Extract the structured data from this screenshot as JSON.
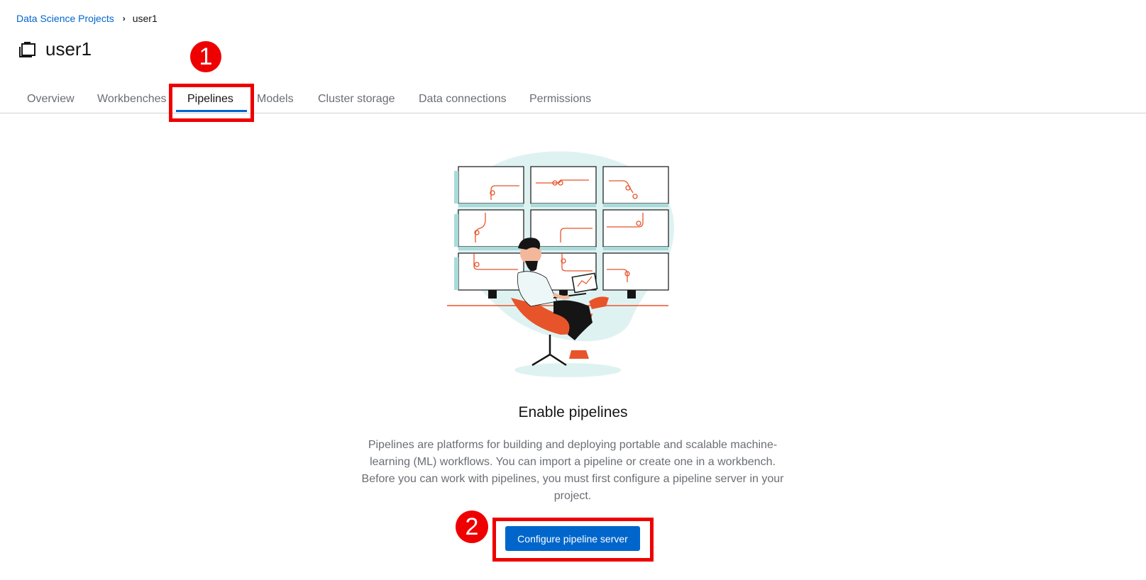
{
  "breadcrumb": {
    "parent": "Data Science Projects",
    "current": "user1"
  },
  "project": {
    "title": "user1",
    "icon": "project-folder-icon"
  },
  "tabs": [
    {
      "label": "Overview",
      "active": false
    },
    {
      "label": "Workbenches",
      "active": false
    },
    {
      "label": "Pipelines",
      "active": true
    },
    {
      "label": "Models",
      "active": false
    },
    {
      "label": "Cluster storage",
      "active": false
    },
    {
      "label": "Data connections",
      "active": false
    },
    {
      "label": "Permissions",
      "active": false
    }
  ],
  "empty_state": {
    "title": "Enable pipelines",
    "body": "Pipelines are platforms for building and deploying portable and scalable machine-learning (ML) workflows. You can import a pipeline or create one in a workbench. Before you can work with pipelines, you must first configure a pipeline server in your project.",
    "button_label": "Configure pipeline server"
  },
  "callouts": [
    "1",
    "2"
  ],
  "colors": {
    "accent": "#0066cc",
    "callout": "#ee0000",
    "illustration_orange": "#e8542a",
    "illustration_teal": "#dff2f2"
  }
}
